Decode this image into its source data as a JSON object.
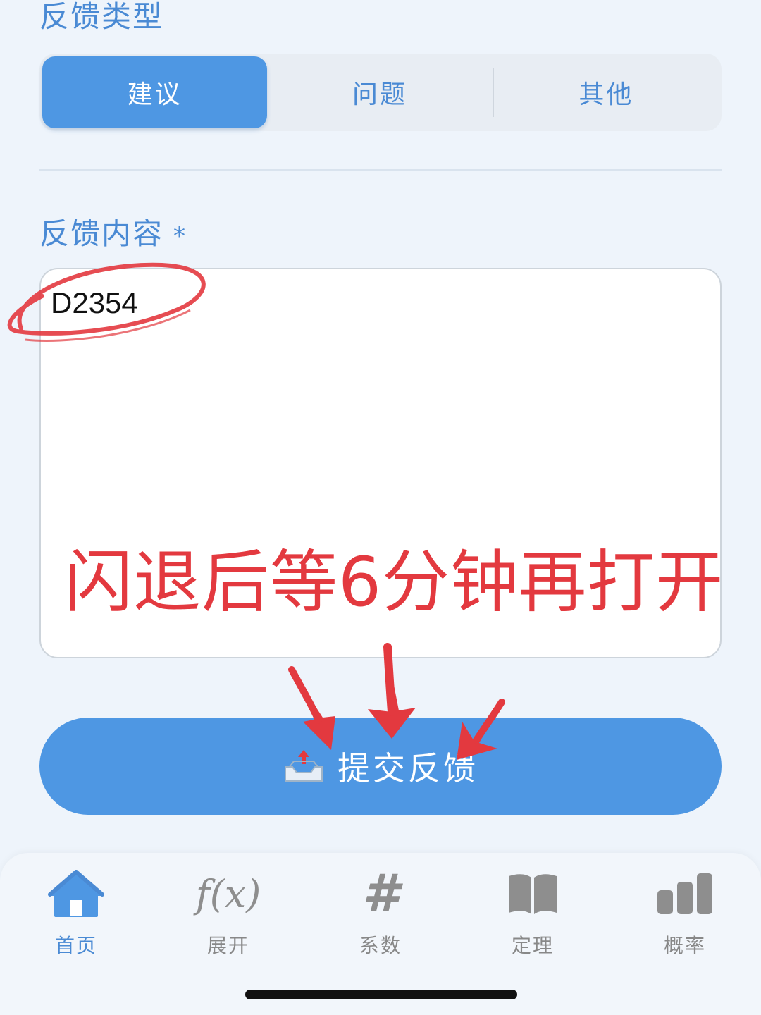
{
  "feedback_type": {
    "title": "反馈类型",
    "options": [
      {
        "label": "建议",
        "active": true
      },
      {
        "label": "问题",
        "active": false
      },
      {
        "label": "其他",
        "active": false
      }
    ]
  },
  "feedback_content": {
    "title": "反馈内容",
    "required_mark": "*",
    "value": "D2354"
  },
  "annotation": {
    "text": "闪退后等6分钟再打开",
    "color": "#e3393f"
  },
  "submit": {
    "label": "提交反馈",
    "icon": "outbox-tray-icon"
  },
  "tabbar": {
    "items": [
      {
        "label": "首页",
        "icon": "home-icon",
        "active": true
      },
      {
        "label": "展开",
        "icon": "function-fx-icon",
        "glyph": "f(x)",
        "active": false
      },
      {
        "label": "系数",
        "icon": "hash-icon",
        "glyph": "#",
        "active": false
      },
      {
        "label": "定理",
        "icon": "book-icon",
        "active": false
      },
      {
        "label": "概率",
        "icon": "bar-chart-icon",
        "active": false
      }
    ]
  },
  "colors": {
    "accent": "#4e97e3",
    "accent_text": "#4a8ad4",
    "background": "#eef4fb",
    "inactive": "#8e8e8e"
  }
}
